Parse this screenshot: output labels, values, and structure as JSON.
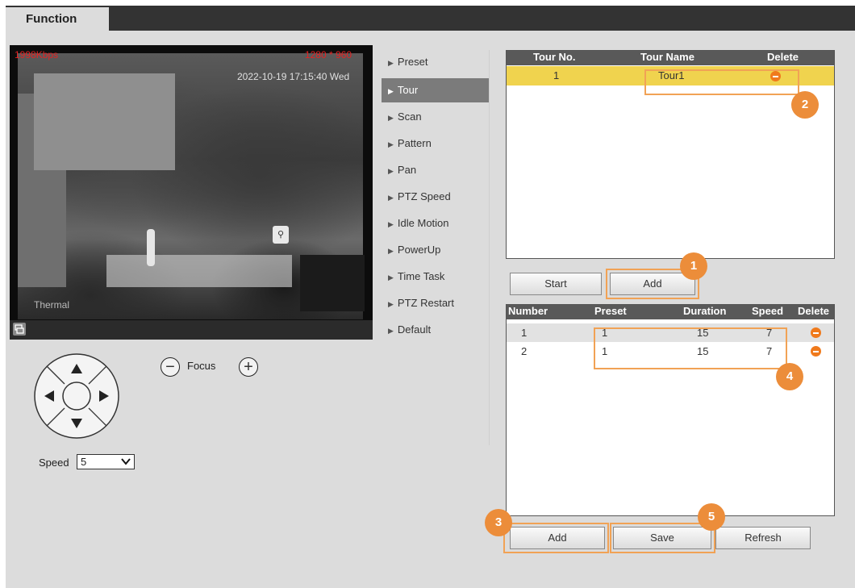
{
  "header": {
    "tab_label": "Function"
  },
  "video": {
    "bitrate": "1998Kbps",
    "resolution": "1280 * 960",
    "timestamp": "2022-10-19 17:15:40 Wed",
    "channel_label": "Thermal"
  },
  "ptz": {
    "focus_label": "Focus",
    "focus_minus": "−",
    "focus_plus": "+",
    "speed_label": "Speed",
    "speed_value": "5"
  },
  "menu": {
    "items": [
      "Preset",
      "Tour",
      "Scan",
      "Pattern",
      "Pan",
      "PTZ Speed",
      "Idle Motion",
      "PowerUp",
      "Time Task",
      "PTZ Restart",
      "Default"
    ],
    "active": "Tour"
  },
  "tour_table": {
    "headers": {
      "no": "Tour No.",
      "name": "Tour Name",
      "delete": "Delete"
    },
    "rows": [
      {
        "no": "1",
        "name": "Tour1"
      }
    ]
  },
  "tour_buttons": {
    "start": "Start",
    "add": "Add"
  },
  "preset_table": {
    "headers": {
      "number": "Number",
      "preset": "Preset",
      "duration": "Duration",
      "speed": "Speed",
      "delete": "Delete"
    },
    "rows": [
      {
        "number": "1",
        "preset": "1",
        "duration": "15",
        "speed": "7"
      },
      {
        "number": "2",
        "preset": "1",
        "duration": "15",
        "speed": "7"
      }
    ]
  },
  "bottom_buttons": {
    "add": "Add",
    "save": "Save",
    "refresh": "Refresh"
  },
  "annotations": {
    "b1": "1",
    "b2": "2",
    "b3": "3",
    "b4": "4",
    "b5": "5"
  },
  "colors": {
    "accent": "#ec8d3a",
    "selected_row": "#f0d34e",
    "header": "#595959",
    "delete": "#f07a1c"
  }
}
